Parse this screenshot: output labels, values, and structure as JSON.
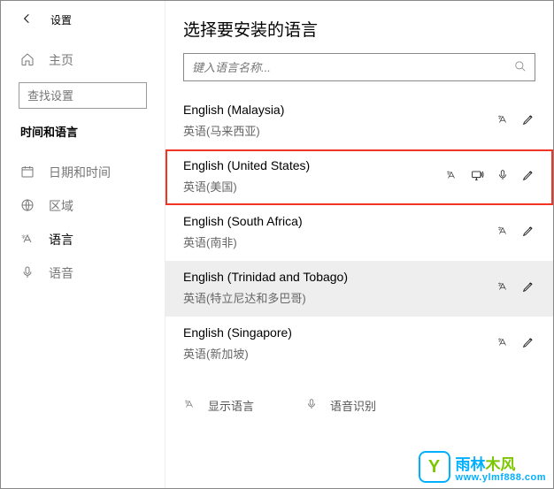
{
  "topbar": {
    "title": "设置"
  },
  "sidebar": {
    "home_label": "主页",
    "search_placeholder": "查找设置",
    "section": "时间和语言",
    "items": [
      {
        "label": "日期和时间"
      },
      {
        "label": "区域"
      },
      {
        "label": "语言"
      },
      {
        "label": "语音"
      }
    ]
  },
  "right": {
    "heading": "选择要安装的语言",
    "search_placeholder": "键入语言名称...",
    "bottom_label": "显示语言",
    "bottom_label2": "语音识别"
  },
  "languages": [
    {
      "en": "English (Malaysia)",
      "zh": "英语(马来西亚)"
    },
    {
      "en": "English (United States)",
      "zh": "英语(美国)"
    },
    {
      "en": "English (South Africa)",
      "zh": "英语(南非)"
    },
    {
      "en": "English (Trinidad and Tobago)",
      "zh": "英语(特立尼达和多巴哥)"
    },
    {
      "en": "English (Singapore)",
      "zh": "英语(新加坡)"
    }
  ],
  "watermark": {
    "brand_a": "雨林",
    "brand_b": "木风",
    "url": "www.ylmf888.com"
  }
}
